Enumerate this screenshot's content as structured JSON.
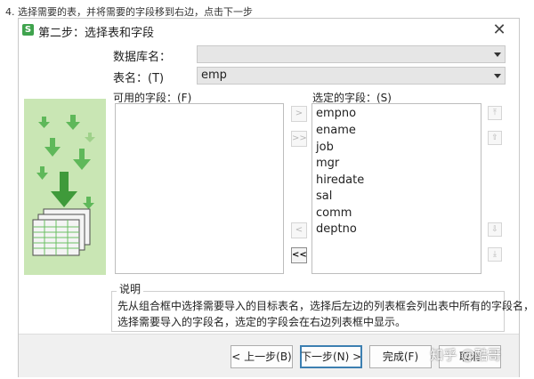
{
  "caption": "4. 选择需要的表，并将需要的字段移到右边，点击下一步",
  "dialog": {
    "icon_letter": "S",
    "title": "第二步：选择表和字段",
    "close_glyph": "✕",
    "database_label": "数据库名：",
    "database_value": "",
    "table_label": "表名：(T)",
    "table_value": "emp",
    "available_label": "可用的字段：(F)",
    "selected_label": "选定的字段：(S)",
    "available_fields": [],
    "selected_fields": [
      "empno",
      "ename",
      "job",
      "mgr",
      "hiredate",
      "sal",
      "comm",
      "deptno"
    ],
    "move_buttons": {
      "add_one": ">",
      "add_all": ">>",
      "remove_one": "<",
      "remove_all": "<<"
    },
    "order_buttons": {
      "move_top": "⤒",
      "move_up": "⇧",
      "move_down": "⇩",
      "move_bottom": "⤓"
    },
    "description_title": "说明",
    "description_lines": [
      "先从组合框中选择需要导入的目标表名，选择后左边的列表框会列出表中所有的字段名，",
      "选择需要导入的字段名，选定的字段会在右边列表框中显示。"
    ],
    "buttons": {
      "prev": "< 上一步(B)",
      "next": "下一步(N) >",
      "finish": "完成(F)",
      "cancel": "取消"
    },
    "watermark": "知乎 @酷哥"
  },
  "colors": {
    "accent_green": "#3fa34d",
    "illustration_bg": "#c9e6b4",
    "combo_bg": "#e6e6e6",
    "default_button_border": "#3c7fb1"
  }
}
